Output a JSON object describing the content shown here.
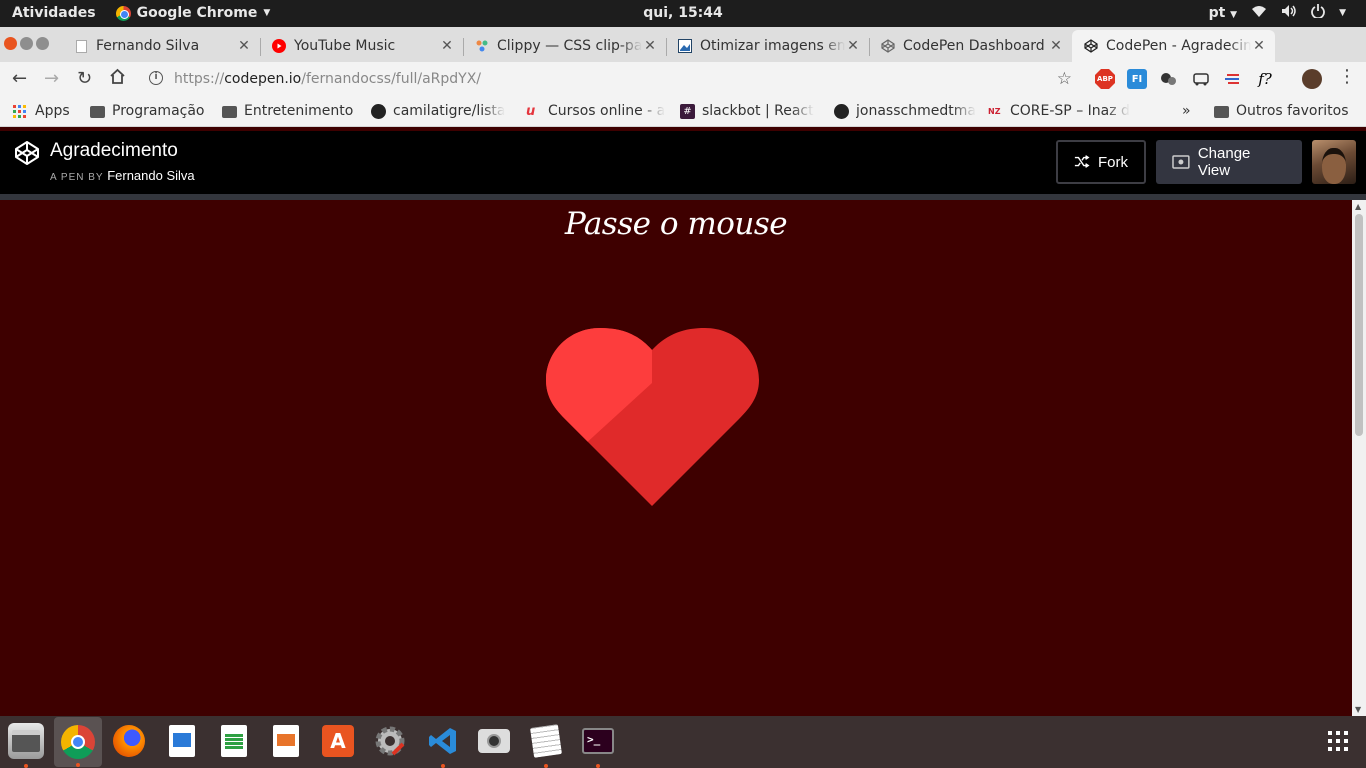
{
  "system": {
    "activities": "Atividades",
    "app_name": "Google Chrome",
    "clock": "qui, 15:44",
    "lang": "pt"
  },
  "tabs": [
    {
      "title": "Fernando Silva"
    },
    {
      "title": "YouTube Music"
    },
    {
      "title": "Clippy — CSS clip-path maker"
    },
    {
      "title": "Otimizar imagens em"
    },
    {
      "title": "CodePen Dashboard"
    },
    {
      "title": "CodePen - Agradecimento",
      "active": true
    }
  ],
  "address": {
    "scheme": "https://",
    "host": "codepen.io",
    "path": "/fernandocss/full/aRpdYX/"
  },
  "extensions": {
    "abp": "ABP",
    "fi": "FI",
    "fx": "f?"
  },
  "bookmarks": [
    {
      "label": "Apps",
      "icon": "apps-grid-icon"
    },
    {
      "label": "Programação",
      "icon": "folder-icon"
    },
    {
      "label": "Entretenimento",
      "icon": "folder-icon"
    },
    {
      "label": "camilatigre/lista",
      "icon": "github-icon"
    },
    {
      "label": "Cursos online - a",
      "icon": "udemy-icon"
    },
    {
      "label": "slackbot | React",
      "icon": "slack-icon"
    },
    {
      "label": "jonasschmedtma",
      "icon": "github-icon"
    },
    {
      "label": "CORE-SP – Inaz d",
      "icon": "core-icon"
    },
    {
      "label": "Outros favoritos",
      "icon": "folder-icon"
    }
  ],
  "more_bookmarks": "»",
  "codepen": {
    "pen_title": "Agradecimento",
    "by_prefix": "A PEN BY",
    "author": "Fernando Silva",
    "fork_label": "Fork",
    "change_view_label": "Change View"
  },
  "pen": {
    "heading": "Passe o mouse",
    "background_color": "#3e0000",
    "heart_colors": [
      "#fd3d3d",
      "#e02a2a"
    ]
  },
  "dock": [
    {
      "name": "files-icon"
    },
    {
      "name": "chrome-icon"
    },
    {
      "name": "firefox-icon"
    },
    {
      "name": "writer-icon"
    },
    {
      "name": "calc-icon"
    },
    {
      "name": "impress-icon"
    },
    {
      "name": "software-icon"
    },
    {
      "name": "settings-icon"
    },
    {
      "name": "vscode-icon"
    },
    {
      "name": "screenshot-icon"
    },
    {
      "name": "text-editor-icon"
    },
    {
      "name": "terminal-icon"
    }
  ]
}
